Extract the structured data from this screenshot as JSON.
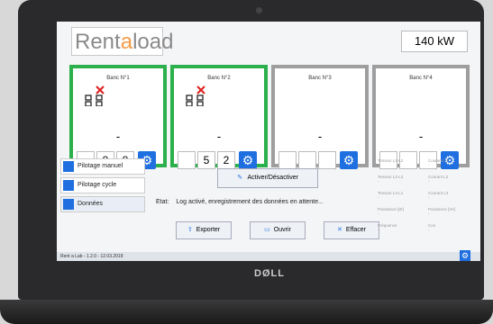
{
  "app": {
    "logo_prefix": "Rent",
    "logo_accent": "a",
    "logo_suffix": "load",
    "power_readout": "140 kW",
    "version": "Rent a Lab - 1.2.0 - 12.03.2018"
  },
  "banks": [
    {
      "title": "Banc N°1",
      "value": "-",
      "cells": [
        "",
        "8",
        "8"
      ],
      "active": true
    },
    {
      "title": "Banc N°2",
      "value": "-",
      "cells": [
        "",
        "5",
        "2"
      ],
      "active": true
    },
    {
      "title": "Banc N°3",
      "value": "-",
      "cells": [
        "",
        "",
        ""
      ],
      "active": false
    },
    {
      "title": "Banc N°4",
      "value": "-",
      "cells": [
        "",
        "",
        ""
      ],
      "active": false
    }
  ],
  "menu": {
    "items": [
      "Pilotage manuel",
      "Pilotage cycle",
      "Données"
    ]
  },
  "controls": {
    "activate_label": "Activer/Désactiver",
    "etat_label": "Etat:",
    "etat_text": "Log activé, enregistrement des données en attente...",
    "export_label": "Exporter",
    "open_label": "Ouvrir",
    "clear_label": "Effacer"
  },
  "metrics": {
    "items": [
      {
        "label": "Tension L1-L2",
        "value": "-"
      },
      {
        "label": "Courant L1",
        "value": "-"
      },
      {
        "label": "Tension L2-L3",
        "value": "-"
      },
      {
        "label": "Courant L2",
        "value": "-"
      },
      {
        "label": "Tension L3-L1",
        "value": "-"
      },
      {
        "label": "Courant L3",
        "value": "-"
      },
      {
        "label": "Puissance [W]",
        "value": "-"
      },
      {
        "label": "Puissance [VA]",
        "value": "-"
      },
      {
        "label": "Fréquence",
        "value": "-"
      },
      {
        "label": "Cos",
        "value": "-"
      }
    ]
  },
  "device": {
    "brand": "DØLL"
  },
  "colors": {
    "accent": "#f39a46",
    "active_border": "#2cb04b",
    "inactive_border": "#9e9e9e",
    "button_blue": "#1f6fe0"
  }
}
